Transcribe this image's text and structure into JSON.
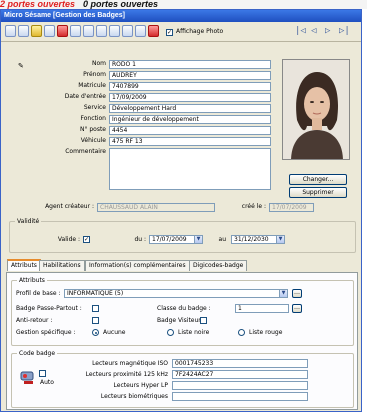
{
  "background_strip": {
    "text_red": "2 portes ouvertes",
    "text_black": "0 portes ouvertes"
  },
  "window": {
    "title": "Micro Sésame [Gestion des Badges]"
  },
  "toolbar": {
    "affichage_photo_label": "Affichage Photo",
    "affichage_photo_checked": true,
    "nav_buttons": [
      "|◁",
      "◁",
      "▷",
      "▷|"
    ]
  },
  "form": {
    "nom": {
      "label": "Nom",
      "value": "RODO 1"
    },
    "prenom": {
      "label": "Prénom",
      "value": "AUDREY"
    },
    "matricule": {
      "label": "Matricule",
      "value": "7407899"
    },
    "date_entree": {
      "label": "Date d'entrée",
      "value": "17/09/2009"
    },
    "service": {
      "label": "Service",
      "value": "Développement Hard"
    },
    "fonction": {
      "label": "Fonction",
      "value": "Ingénieur de développement"
    },
    "poste": {
      "label": "N° poste",
      "value": "4454"
    },
    "vehicule": {
      "label": "Véhicule",
      "value": "475 RF 13"
    },
    "commentaire": {
      "label": "Commentaire",
      "value": ""
    },
    "agent_createur": {
      "label": "Agent créateur :",
      "value": "CHAUSSAUD ALAIN"
    },
    "cree_le": {
      "label": "créé le :",
      "value": "17/07/2009"
    },
    "photo_buttons": {
      "changer": "Changer...",
      "supprimer": "Supprimer"
    }
  },
  "validite": {
    "group_title": "Validité",
    "valide_label": "Valide :",
    "valide_checked": true,
    "du_label": "du :",
    "du_value": "17/07/2009",
    "au_label": "au",
    "au_value": "31/12/2030"
  },
  "tabs": [
    "Attributs",
    "Habilitations",
    "Information(s) complémentaires",
    "Digicodes-badge"
  ],
  "attributs": {
    "group_title": "Attributs",
    "profil_label": "Profil de base :",
    "profil_value": "INFORMATIQUE (5)",
    "badge_passe_label": "Badge Passe-Partout :",
    "classe_label": "Classe du badge :",
    "classe_value": "1",
    "antiretour_label": "Anti-retour :",
    "badge_visiteur_label": "Badge Visiteur",
    "gestion_label": "Gestion spécifique :",
    "gestion_options": [
      "Aucune",
      "Liste noire",
      "Liste rouge"
    ],
    "gestion_selected": 0
  },
  "code_badge": {
    "group_title": "Code badge",
    "auto_label": "Auto",
    "iso_label": "Lecteurs magnétique ISO",
    "iso_value": "0001745233",
    "prox_label": "Lecteurs proximité 125 kHz",
    "prox_value": "7F2424AC27",
    "hyper_label": "Lecteurs Hyper LP",
    "hyper_value": "",
    "bio_label": "Lecteurs biométriques",
    "bio_value": ""
  },
  "colors": {
    "strip_red": "#e02020",
    "title_blue": "#1f4fbf",
    "window_bg": "#ece9d8",
    "tab_accent": "#e68b2c"
  }
}
